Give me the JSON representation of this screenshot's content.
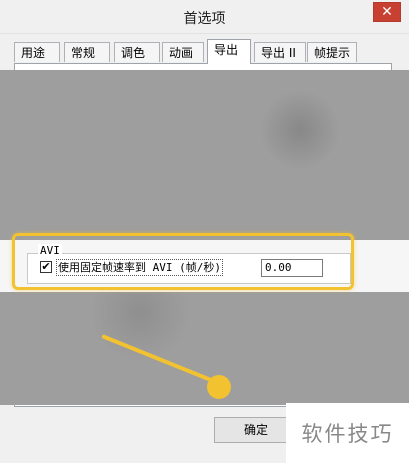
{
  "window": {
    "title": "首选项",
    "close_label": "✕"
  },
  "tabs": [
    {
      "label": "用途"
    },
    {
      "label": "常规"
    },
    {
      "label": "调色板"
    },
    {
      "label": "动画"
    },
    {
      "label": "导出"
    },
    {
      "label": "导出 II"
    },
    {
      "label": "帧提示"
    }
  ],
  "active_tab": "导出",
  "avi_group": {
    "title": "AVI",
    "checkbox_checked": true,
    "checkbox_mark": "✔",
    "checkbox_label": "使用固定帧速率到 AVI (帧/秒)",
    "fps_value": "0.00"
  },
  "footer": {
    "ok_label": "确定"
  },
  "watermark": "软件技巧",
  "colors": {
    "highlight": "#f2c230",
    "close_button": "#c84031"
  }
}
